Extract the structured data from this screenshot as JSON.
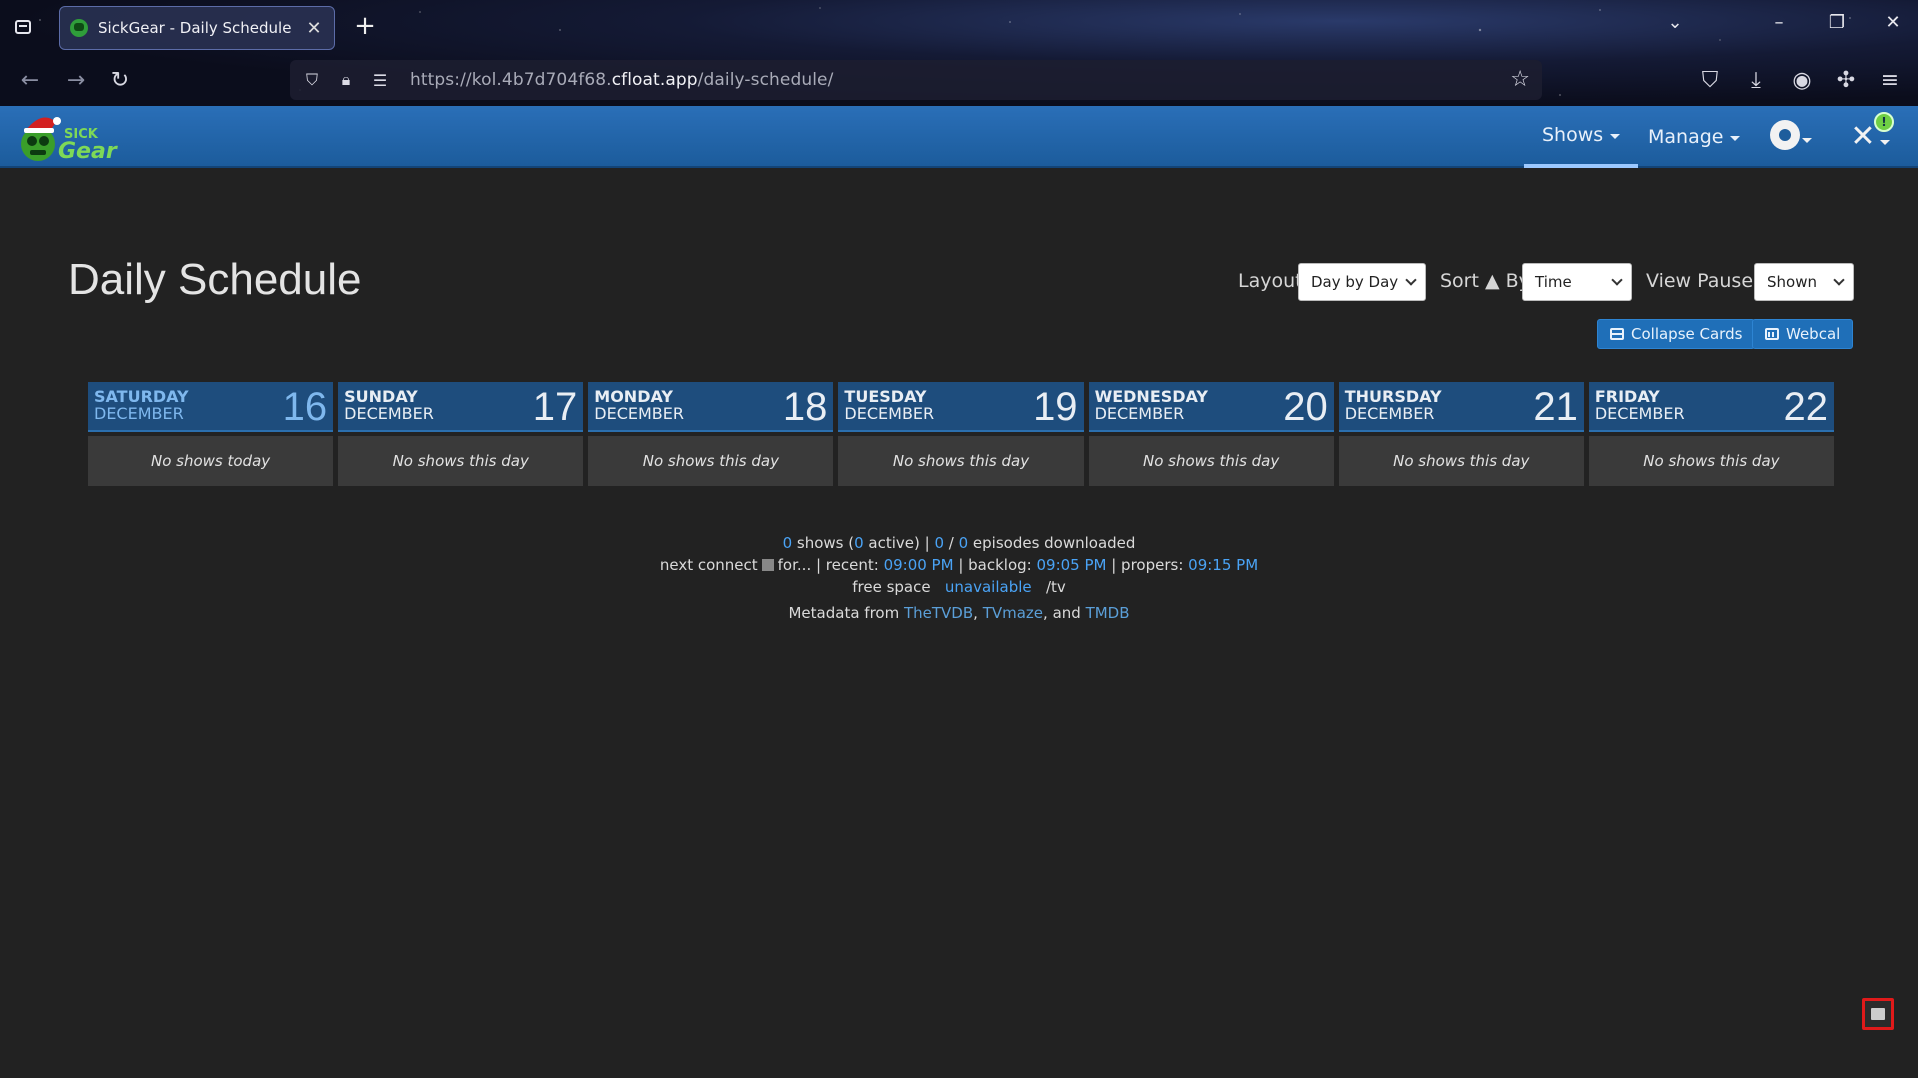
{
  "browser": {
    "tab_title": "SickGear - Daily Schedule",
    "url_prefix": "https://kol.4b7d704f68.",
    "url_domain": "cfloat.app",
    "url_path": "/daily-schedule/"
  },
  "nav": {
    "shows": "Shows",
    "manage": "Manage",
    "notification_count": "!"
  },
  "page": {
    "title": "Daily Schedule",
    "layout_label": "Layout",
    "layout_value": "Day by Day",
    "sort_label": "Sort ▲ By",
    "sort_value": "Time",
    "paused_label": "View Paused",
    "paused_value": "Shown",
    "collapse_label": "Collapse Cards",
    "webcal_label": "Webcal"
  },
  "days": [
    {
      "name": "SATURDAY",
      "month": "DECEMBER",
      "num": "16",
      "text": "No shows today"
    },
    {
      "name": "SUNDAY",
      "month": "DECEMBER",
      "num": "17",
      "text": "No shows this day"
    },
    {
      "name": "MONDAY",
      "month": "DECEMBER",
      "num": "18",
      "text": "No shows this day"
    },
    {
      "name": "TUESDAY",
      "month": "DECEMBER",
      "num": "19",
      "text": "No shows this day"
    },
    {
      "name": "WEDNESDAY",
      "month": "DECEMBER",
      "num": "20",
      "text": "No shows this day"
    },
    {
      "name": "THURSDAY",
      "month": "DECEMBER",
      "num": "21",
      "text": "No shows this day"
    },
    {
      "name": "FRIDAY",
      "month": "DECEMBER",
      "num": "22",
      "text": "No shows this day"
    }
  ],
  "footer": {
    "shows_count": "0",
    "shows_text": " shows (",
    "active_count": "0",
    "active_text": " active) | ",
    "downloaded": "0",
    "slash": " / ",
    "episodes": "0",
    "episodes_text": " episodes downloaded",
    "next_connect": "next connect",
    "for_text": "for... | recent: ",
    "recent_time": "09:00 PM",
    "backlog_text": " | backlog: ",
    "backlog_time": "09:05 PM",
    "propers_text": " | propers: ",
    "propers_time": "09:15 PM",
    "free_space": "free space",
    "free_value": "unavailable",
    "tv_path": "/tv",
    "metadata_text": "Metadata from ",
    "tvdb": "TheTVDB",
    "tvmaze": "TVmaze",
    "and_text": ", and ",
    "tmdb": "TMDB"
  }
}
